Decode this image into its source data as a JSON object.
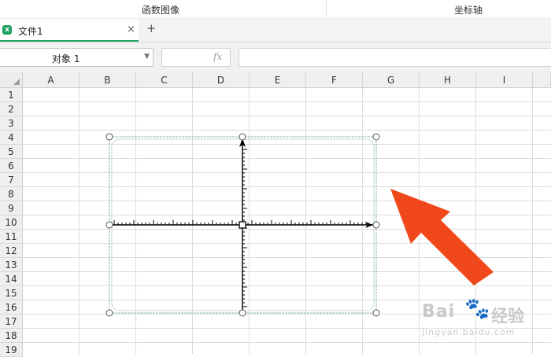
{
  "ribbon": {
    "groups": [
      "函数图像",
      "坐标轴"
    ]
  },
  "tabbar": {
    "tab_label": "文件1",
    "close_glyph": "×",
    "add_glyph": "+"
  },
  "formula": {
    "name_box_value": "对象  1",
    "fx_label": "fx",
    "formula_value": ""
  },
  "grid": {
    "columns": [
      "A",
      "B",
      "C",
      "D",
      "E",
      "F",
      "G",
      "H",
      "I"
    ],
    "rows": [
      "1",
      "2",
      "3",
      "4",
      "5",
      "6",
      "7",
      "8",
      "9",
      "10",
      "11",
      "12",
      "13",
      "14",
      "15",
      "16",
      "17",
      "18",
      "19"
    ]
  },
  "annotation": {
    "arrow_color": "#f0481a"
  },
  "watermark": {
    "logo": "Bai",
    "paw": "🐾",
    "name": "经验",
    "url": "jingyan.baidu.com"
  },
  "colors": {
    "tab_accent": "#1fa463",
    "frame_color": "#8ab5b6"
  }
}
